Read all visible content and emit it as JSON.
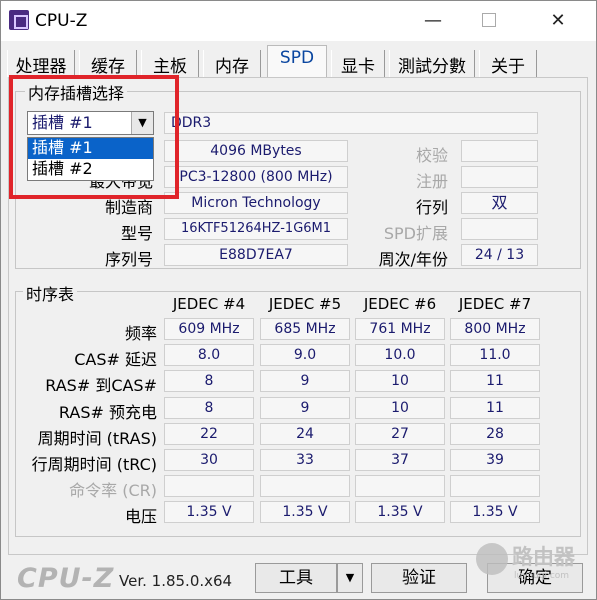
{
  "window": {
    "title": "CPU-Z",
    "min_glyph": "—",
    "max_glyph": "",
    "close_glyph": "✕"
  },
  "tabs": [
    {
      "label": "处理器"
    },
    {
      "label": "缓存"
    },
    {
      "label": "主板"
    },
    {
      "label": "内存"
    },
    {
      "label": "SPD"
    },
    {
      "label": "显卡"
    },
    {
      "label": "測試分數"
    },
    {
      "label": "关于"
    }
  ],
  "active_tab": "SPD",
  "slot_group": {
    "label": "内存插槽选择",
    "selected": "插槽 #1",
    "options": [
      "插槽 #1",
      "插槽 #2"
    ],
    "type_value": "DDR3",
    "size_value": "4096 MBytes",
    "bandwidth_label": "最大带宽",
    "bandwidth_value": "PC3-12800 (800 MHz)",
    "manufacturer_label": "制造商",
    "manufacturer_value": "Micron Technology",
    "part_label": "型号",
    "part_value": "16KTF51264HZ-1G6M1",
    "serial_label": "序列号",
    "serial_value": "E88D7EA7",
    "ecc_label": "校验",
    "registered_label": "注册",
    "ranks_label": "行列",
    "ranks_value": "双",
    "spd_ext_label": "SPD扩展",
    "week_year_label": "周次/年份",
    "week_year_value": "24 / 13"
  },
  "timing_group": {
    "label": "时序表",
    "columns": [
      "JEDEC #4",
      "JEDEC #5",
      "JEDEC #6",
      "JEDEC #7"
    ],
    "rows": [
      {
        "label": "频率",
        "values": [
          "609 MHz",
          "685 MHz",
          "761 MHz",
          "800 MHz"
        ],
        "gray": false
      },
      {
        "label": "CAS# 延迟",
        "values": [
          "8.0",
          "9.0",
          "10.0",
          "11.0"
        ],
        "gray": false
      },
      {
        "label": "RAS# 到CAS#",
        "values": [
          "8",
          "9",
          "10",
          "11"
        ],
        "gray": false
      },
      {
        "label": "RAS# 预充电",
        "values": [
          "8",
          "9",
          "10",
          "11"
        ],
        "gray": false
      },
      {
        "label": "周期时间 (tRAS)",
        "values": [
          "22",
          "24",
          "27",
          "28"
        ],
        "gray": false
      },
      {
        "label": "行周期时间 (tRC)",
        "values": [
          "30",
          "33",
          "37",
          "39"
        ],
        "gray": false
      },
      {
        "label": "命令率 (CR)",
        "values": [
          "",
          "",
          "",
          ""
        ],
        "gray": true
      },
      {
        "label": "电压",
        "values": [
          "1.35 V",
          "1.35 V",
          "1.35 V",
          "1.35 V"
        ],
        "gray": false
      }
    ]
  },
  "footer": {
    "brand": "CPU-Z",
    "version": "Ver. 1.85.0.x64",
    "tools_label": "工具",
    "validate_label": "验证",
    "ok_label": "确定"
  },
  "watermark": {
    "text": "路由器",
    "url": "luyouqi.com"
  },
  "colors": {
    "highlight": "#e0242a",
    "selection": "#0a63c9",
    "value_text": "#1b1b6e"
  }
}
